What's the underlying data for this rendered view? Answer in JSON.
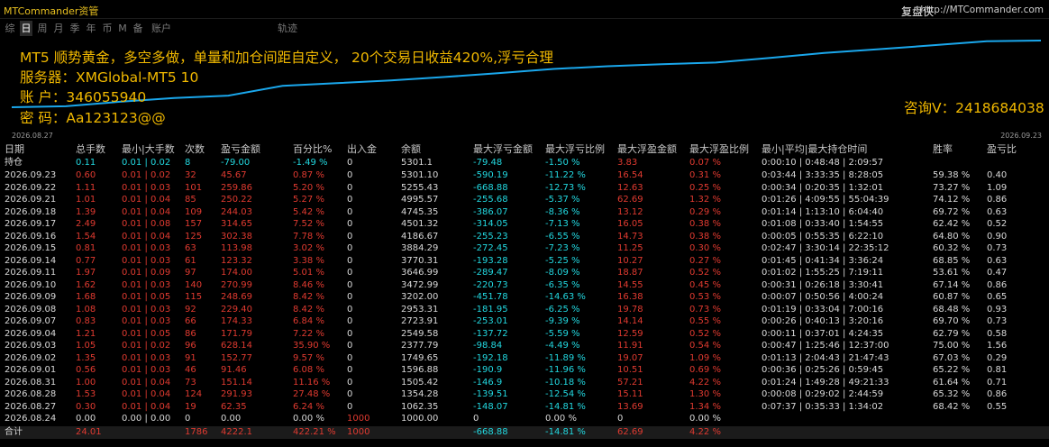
{
  "app_title": "MTCommander资管",
  "site": {
    "label": "复盘侠",
    "url": "http://MTCommander.com"
  },
  "tabs": [
    "综",
    "日",
    "周",
    "月",
    "季",
    "年",
    "币",
    "M",
    "备",
    "账户",
    "轨迹"
  ],
  "selected_tab": 1,
  "overlay": {
    "line1": "MT5 顺势黄金，多空多做，单量和加仓间距自定义， 20个交易日收益420%,浮亏合理",
    "line2": "服务器：XMGlobal-MT5  10",
    "line3": "账    户：346055940",
    "line4": "密    码：Aa123123@@",
    "contact": "咨询V：2418684038"
  },
  "chart_data": {
    "type": "line",
    "x_start": "2026.08.27",
    "x_end": "2026.09.23",
    "x": [
      "2026.08.24",
      "2026.08.27",
      "2026.08.28",
      "2026.09.01",
      "2026.09.02",
      "2026.09.03",
      "2026.09.04",
      "2026.09.07",
      "2026.09.08",
      "2026.09.09",
      "2026.09.10",
      "2026.09.11",
      "2026.09.14",
      "2026.09.15",
      "2026.09.16",
      "2026.09.17",
      "2026.09.18",
      "2026.09.21",
      "2026.09.22",
      "2026.09.23"
    ],
    "values": [
      1000,
      1062.35,
      1354.28,
      1596.88,
      1749.65,
      2377.79,
      2549.58,
      2723.91,
      2953.31,
      3202,
      3472.99,
      3646.99,
      3770.31,
      3884.29,
      4186.67,
      4501.32,
      4745.35,
      4995.57,
      5255.43,
      5301.1
    ],
    "color": "#1aa7ec"
  },
  "columns": [
    "日期",
    "总手数",
    "最小|大手数",
    "次数",
    "盈亏金额",
    "百分比%",
    "出入金",
    "余额",
    "最大浮亏金额",
    "最大浮亏比例",
    "最大浮盈金额",
    "最大浮盈比例",
    "最小|平均|最大持仓时间",
    "胜率",
    "盈亏比"
  ],
  "holding": {
    "label": "持仓",
    "lots": "0.11",
    "minmax": "0.01 | 0.02",
    "count": "8",
    "pnl": "-79.00",
    "pct": "-1.49 %",
    "io": "0",
    "balance": "5301.1",
    "mfl": "-79.48",
    "mflp": "-1.50 %",
    "mfp": "3.83",
    "mfpp": "0.07 %",
    "time": "0:00:10 | 0:48:48 | 2:09:57",
    "win": "",
    "pf": ""
  },
  "rows": [
    {
      "date": "2026.09.23",
      "lots": "0.60",
      "minmax": "0.01 | 0.02",
      "count": "32",
      "pnl": "45.67",
      "pct": "0.87 %",
      "io": "0",
      "balance": "5301.10",
      "mfl": "-590.19",
      "mflp": "-11.22 %",
      "mfp": "16.54",
      "mfpp": "0.31 %",
      "time": "0:03:44 | 3:33:35 | 8:28:05",
      "win": "59.38 %",
      "pf": "0.40"
    },
    {
      "date": "2026.09.22",
      "lots": "1.11",
      "minmax": "0.01 | 0.03",
      "count": "101",
      "pnl": "259.86",
      "pct": "5.20 %",
      "io": "0",
      "balance": "5255.43",
      "mfl": "-668.88",
      "mflp": "-12.73 %",
      "mfp": "12.63",
      "mfpp": "0.25 %",
      "time": "0:00:34 | 0:20:35 | 1:32:01",
      "win": "73.27 %",
      "pf": "1.09"
    },
    {
      "date": "2026.09.21",
      "lots": "1.01",
      "minmax": "0.01 | 0.04",
      "count": "85",
      "pnl": "250.22",
      "pct": "5.27 %",
      "io": "0",
      "balance": "4995.57",
      "mfl": "-255.68",
      "mflp": "-5.37 %",
      "mfp": "62.69",
      "mfpp": "1.32 %",
      "time": "0:01:26 | 4:09:55 | 55:04:39",
      "win": "74.12 %",
      "pf": "0.86"
    },
    {
      "date": "2026.09.18",
      "lots": "1.39",
      "minmax": "0.01 | 0.04",
      "count": "109",
      "pnl": "244.03",
      "pct": "5.42 %",
      "io": "0",
      "balance": "4745.35",
      "mfl": "-386.07",
      "mflp": "-8.36 %",
      "mfp": "13.12",
      "mfpp": "0.29 %",
      "time": "0:01:14 | 1:13:10 | 6:04:40",
      "win": "69.72 %",
      "pf": "0.63"
    },
    {
      "date": "2026.09.17",
      "lots": "2.49",
      "minmax": "0.01 | 0.08",
      "count": "157",
      "pnl": "314.65",
      "pct": "7.52 %",
      "io": "0",
      "balance": "4501.32",
      "mfl": "-314.05",
      "mflp": "-7.13 %",
      "mfp": "16.05",
      "mfpp": "0.38 %",
      "time": "0:01:08 | 0:33:40 | 1:54:55",
      "win": "62.42 %",
      "pf": "0.52"
    },
    {
      "date": "2026.09.16",
      "lots": "1.54",
      "minmax": "0.01 | 0.04",
      "count": "125",
      "pnl": "302.38",
      "pct": "7.78 %",
      "io": "0",
      "balance": "4186.67",
      "mfl": "-255.23",
      "mflp": "-6.55 %",
      "mfp": "14.73",
      "mfpp": "0.38 %",
      "time": "0:00:05 | 0:55:35 | 6:22:10",
      "win": "64.80 %",
      "pf": "0.90"
    },
    {
      "date": "2026.09.15",
      "lots": "0.81",
      "minmax": "0.01 | 0.03",
      "count": "63",
      "pnl": "113.98",
      "pct": "3.02 %",
      "io": "0",
      "balance": "3884.29",
      "mfl": "-272.45",
      "mflp": "-7.23 %",
      "mfp": "11.25",
      "mfpp": "0.30 %",
      "time": "0:02:47 | 3:30:14 | 22:35:12",
      "win": "60.32 %",
      "pf": "0.73"
    },
    {
      "date": "2026.09.14",
      "lots": "0.77",
      "minmax": "0.01 | 0.03",
      "count": "61",
      "pnl": "123.32",
      "pct": "3.38 %",
      "io": "0",
      "balance": "3770.31",
      "mfl": "-193.28",
      "mflp": "-5.25 %",
      "mfp": "10.27",
      "mfpp": "0.27 %",
      "time": "0:01:45 | 0:41:34 | 3:36:24",
      "win": "68.85 %",
      "pf": "0.63"
    },
    {
      "date": "2026.09.11",
      "lots": "1.97",
      "minmax": "0.01 | 0.09",
      "count": "97",
      "pnl": "174.00",
      "pct": "5.01 %",
      "io": "0",
      "balance": "3646.99",
      "mfl": "-289.47",
      "mflp": "-8.09 %",
      "mfp": "18.87",
      "mfpp": "0.52 %",
      "time": "0:01:02 | 1:55:25 | 7:19:11",
      "win": "53.61 %",
      "pf": "0.47"
    },
    {
      "date": "2026.09.10",
      "lots": "1.62",
      "minmax": "0.01 | 0.03",
      "count": "140",
      "pnl": "270.99",
      "pct": "8.46 %",
      "io": "0",
      "balance": "3472.99",
      "mfl": "-220.73",
      "mflp": "-6.35 %",
      "mfp": "14.55",
      "mfpp": "0.45 %",
      "time": "0:00:31 | 0:26:18 | 3:30:41",
      "win": "67.14 %",
      "pf": "0.86"
    },
    {
      "date": "2026.09.09",
      "lots": "1.68",
      "minmax": "0.01 | 0.05",
      "count": "115",
      "pnl": "248.69",
      "pct": "8.42 %",
      "io": "0",
      "balance": "3202.00",
      "mfl": "-451.78",
      "mflp": "-14.63 %",
      "mfp": "16.38",
      "mfpp": "0.53 %",
      "time": "0:00:07 | 0:50:56 | 4:00:24",
      "win": "60.87 %",
      "pf": "0.65"
    },
    {
      "date": "2026.09.08",
      "lots": "1.08",
      "minmax": "0.01 | 0.03",
      "count": "92",
      "pnl": "229.40",
      "pct": "8.42 %",
      "io": "0",
      "balance": "2953.31",
      "mfl": "-181.95",
      "mflp": "-6.25 %",
      "mfp": "19.78",
      "mfpp": "0.73 %",
      "time": "0:01:19 | 0:33:04 | 7:00:16",
      "win": "68.48 %",
      "pf": "0.93"
    },
    {
      "date": "2026.09.07",
      "lots": "0.83",
      "minmax": "0.01 | 0.03",
      "count": "66",
      "pnl": "174.33",
      "pct": "6.84 %",
      "io": "0",
      "balance": "2723.91",
      "mfl": "-253.01",
      "mflp": "-9.39 %",
      "mfp": "14.14",
      "mfpp": "0.55 %",
      "time": "0:00:26 | 0:40:13 | 3:20:16",
      "win": "69.70 %",
      "pf": "0.73"
    },
    {
      "date": "2026.09.04",
      "lots": "1.21",
      "minmax": "0.01 | 0.05",
      "count": "86",
      "pnl": "171.79",
      "pct": "7.22 %",
      "io": "0",
      "balance": "2549.58",
      "mfl": "-137.72",
      "mflp": "-5.59 %",
      "mfp": "12.59",
      "mfpp": "0.52 %",
      "time": "0:00:11 | 0:37:01 | 4:24:35",
      "win": "62.79 %",
      "pf": "0.58"
    },
    {
      "date": "2026.09.03",
      "lots": "1.05",
      "minmax": "0.01 | 0.02",
      "count": "96",
      "pnl": "628.14",
      "pct": "35.90 %",
      "io": "0",
      "balance": "2377.79",
      "mfl": "-98.84",
      "mflp": "-4.49 %",
      "mfp": "11.91",
      "mfpp": "0.54 %",
      "time": "0:00:47 | 1:25:46 | 12:37:00",
      "win": "75.00 %",
      "pf": "1.56"
    },
    {
      "date": "2026.09.02",
      "lots": "1.35",
      "minmax": "0.01 | 0.03",
      "count": "91",
      "pnl": "152.77",
      "pct": "9.57 %",
      "io": "0",
      "balance": "1749.65",
      "mfl": "-192.18",
      "mflp": "-11.89 %",
      "mfp": "19.07",
      "mfpp": "1.09 %",
      "time": "0:01:13 | 2:04:43 | 21:47:43",
      "win": "67.03 %",
      "pf": "0.29"
    },
    {
      "date": "2026.09.01",
      "lots": "0.56",
      "minmax": "0.01 | 0.03",
      "count": "46",
      "pnl": "91.46",
      "pct": "6.08 %",
      "io": "0",
      "balance": "1596.88",
      "mfl": "-190.9",
      "mflp": "-11.96 %",
      "mfp": "10.51",
      "mfpp": "0.69 %",
      "time": "0:00:36 | 0:25:26 | 0:59:45",
      "win": "65.22 %",
      "pf": "0.81"
    },
    {
      "date": "2026.08.31",
      "lots": "1.00",
      "minmax": "0.01 | 0.04",
      "count": "73",
      "pnl": "151.14",
      "pct": "11.16 %",
      "io": "0",
      "balance": "1505.42",
      "mfl": "-146.9",
      "mflp": "-10.18 %",
      "mfp": "57.21",
      "mfpp": "4.22 %",
      "time": "0:01:24 | 1:49:28 | 49:21:33",
      "win": "61.64 %",
      "pf": "0.71"
    },
    {
      "date": "2026.08.28",
      "lots": "1.53",
      "minmax": "0.01 | 0.04",
      "count": "124",
      "pnl": "291.93",
      "pct": "27.48 %",
      "io": "0",
      "balance": "1354.28",
      "mfl": "-139.51",
      "mflp": "-12.54 %",
      "mfp": "15.11",
      "mfpp": "1.30 %",
      "time": "0:00:08 | 0:29:02 | 2:44:59",
      "win": "65.32 %",
      "pf": "0.86"
    },
    {
      "date": "2026.08.27",
      "lots": "0.30",
      "minmax": "0.01 | 0.04",
      "count": "19",
      "pnl": "62.35",
      "pct": "6.24 %",
      "io": "0",
      "balance": "1062.35",
      "mfl": "-148.07",
      "mflp": "-14.81 %",
      "mfp": "13.69",
      "mfpp": "1.34 %",
      "time": "0:07:37 | 0:35:33 | 1:34:02",
      "win": "68.42 %",
      "pf": "0.55"
    },
    {
      "date": "2026.08.24",
      "lots": "0.00",
      "minmax": "0.00 | 0.00",
      "count": "0",
      "pnl": "0.00",
      "pct": "0.00 %",
      "io": "1000",
      "balance": "1000.00",
      "mfl": "0",
      "mflp": "0.00 %",
      "mfp": "0",
      "mfpp": "0.00 %",
      "time": "",
      "win": "",
      "pf": ""
    }
  ],
  "total": {
    "label": "合计",
    "lots": "24.01",
    "minmax": "",
    "count": "1786",
    "pnl": "4222.1",
    "pct": "422.21 %",
    "io": "1000",
    "balance": "",
    "mfl": "-668.88",
    "mflp": "-14.81 %",
    "mfp": "62.69",
    "mfpp": "4.22 %",
    "time": "",
    "win": "",
    "pf": ""
  },
  "colors": {
    "red": "#e03a30",
    "cyan": "#22d8e0",
    "white": "#d8d8d8",
    "orange": "#f0b800",
    "line": "#1aa7ec"
  }
}
